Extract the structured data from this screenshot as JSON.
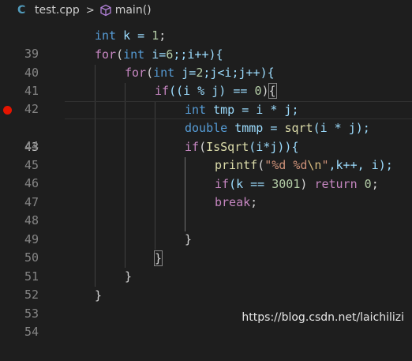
{
  "breadcrumb": {
    "file_icon": "C",
    "file_icon_name": "cpp-file-icon",
    "file_name": "test.cpp",
    "separator": ">",
    "symbol_icon_name": "cube-method-icon",
    "symbol": "main()"
  },
  "editor": {
    "current_line": 43,
    "breakpoint_line": 43,
    "breakpoint_color": "#e51400",
    "lines": [
      {
        "n": "39"
      },
      {
        "n": "40"
      },
      {
        "n": "41"
      },
      {
        "n": "42"
      },
      {
        "n": "43"
      },
      {
        "n": "44"
      },
      {
        "n": "45"
      },
      {
        "n": "46"
      },
      {
        "n": "47"
      },
      {
        "n": "48"
      },
      {
        "n": "49"
      },
      {
        "n": "50"
      },
      {
        "n": "51"
      },
      {
        "n": "52"
      },
      {
        "n": "53"
      },
      {
        "n": "54"
      }
    ],
    "code": {
      "l39": [
        "int",
        " k = ",
        "1",
        ";"
      ],
      "l40": [
        "for",
        "(",
        "int",
        " i=",
        "6",
        ";;i++){"
      ],
      "l41": [
        "for",
        "(",
        "int",
        " j=",
        "2",
        ";j<i;j++){"
      ],
      "l42": [
        "if",
        "((i % j) == ",
        "0",
        ")",
        "{"
      ],
      "l43": [
        "int",
        " tmp = i * j;"
      ],
      "l44": [
        "double",
        " tmmp = ",
        "sqrt",
        "(i * j);"
      ],
      "l45": [
        "if",
        "(",
        "IsSqrt",
        "(i*j)){"
      ],
      "l46": [
        "printf",
        "(",
        "\"%d %d",
        "\\n",
        "\"",
        ",k++, i);"
      ],
      "l47": [
        "if",
        "(k == ",
        "3001",
        ") ",
        "return",
        " ",
        "0",
        ";"
      ],
      "l48": [
        "break",
        ";"
      ],
      "l50": [
        "}"
      ],
      "l51": [
        "}"
      ],
      "l52": [
        "}"
      ],
      "l53": [
        "}"
      ]
    }
  },
  "watermark": "https://blog.csdn.net/laichilizi",
  "colors": {
    "background": "#1e1e1e",
    "keyword": "#569cd6",
    "control": "#c586c0",
    "function": "#dcdcaa",
    "variable": "#9cdcfe",
    "number": "#b5cea8",
    "string": "#ce9178"
  }
}
